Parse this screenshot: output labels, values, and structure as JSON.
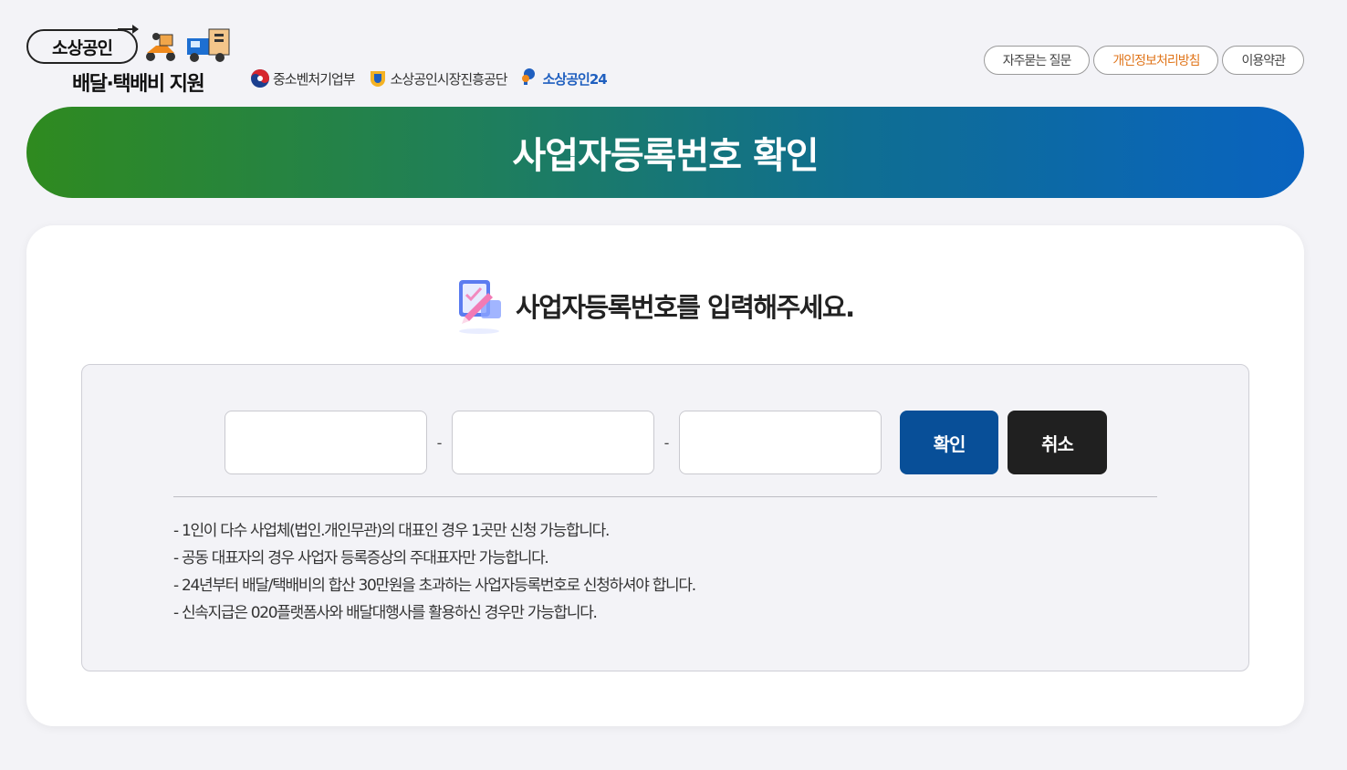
{
  "header": {
    "logo": {
      "pill_text": "소상공인",
      "main_text": "배달·택배비 지원"
    },
    "partners": [
      {
        "label": "중소벤처기업부",
        "icon": "mss-emblem-icon"
      },
      {
        "label": "소상공인시장진흥공단",
        "icon": "semas-logo-icon"
      },
      {
        "label": "소상공인24",
        "icon": "sb24-logo-icon"
      }
    ],
    "top_links": {
      "faq": "자주묻는 질문",
      "privacy": "개인정보처리방침",
      "terms": "이용약관"
    }
  },
  "banner": {
    "title": "사업자등록번호 확인"
  },
  "card": {
    "heading": "사업자등록번호를 입력해주세요.",
    "form": {
      "part1_value": "",
      "part2_value": "",
      "part3_value": "",
      "separator": "-",
      "confirm_label": "확인",
      "cancel_label": "취소"
    },
    "notes": [
      "1인이 다수 사업체(법인.개인무관)의 대표인 경우 1곳만 신청 가능합니다.",
      "공동 대표자의 경우 사업자 등록증상의 주대표자만 가능합니다.",
      "24년부터 배달/택배비의 합산 30만원을 초과하는 사업자등록번호로 신청하셔야 합니다.",
      "신속지급은 020플랫폼사와 배달대행사를 활용하신 경우만 가능합니다."
    ]
  },
  "colors": {
    "banner_start": "#2f8a1f",
    "banner_end": "#0963c0",
    "confirm_button": "#084f98",
    "cancel_button": "#202020",
    "privacy_link": "#e0761c",
    "page_background": "#f3f3f7"
  }
}
